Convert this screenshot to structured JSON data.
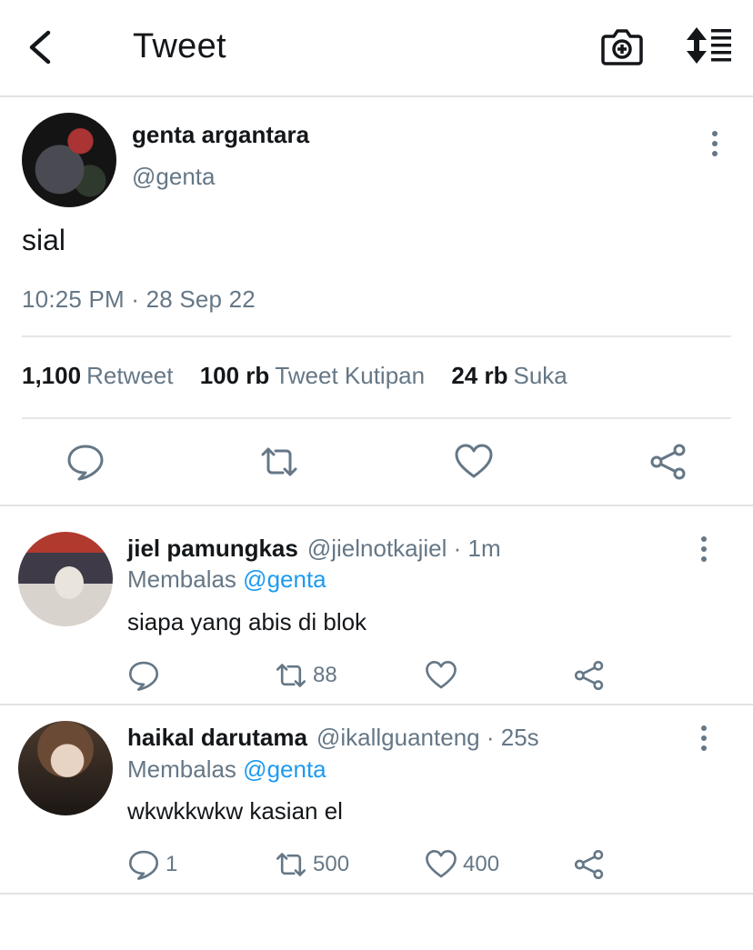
{
  "header": {
    "title": "Tweet",
    "back_icon": "chevron-left-icon",
    "camera_icon": "camera-plus-icon",
    "sort_icon": "sort-list-icon"
  },
  "main_tweet": {
    "name": "genta argantara",
    "handle": "@genta",
    "text": "sial",
    "timestamp": "10:25 PM · 28 Sep 22",
    "stats": {
      "retweets_count": "1,100",
      "retweets_label": "Retweet",
      "quotes_count": "100 rb",
      "quotes_label": "Tweet Kutipan",
      "likes_count": "24 rb",
      "likes_label": "Suka"
    }
  },
  "replies": [
    {
      "name": "jiel pamungkas",
      "handle": "@jielnotkajiel",
      "time": "· 1m",
      "replying_prefix": "Membalas",
      "replying_to": "@genta",
      "text": "siapa yang abis di blok",
      "reply_count": "",
      "retweet_count": "88",
      "like_count": ""
    },
    {
      "name": "haikal darutama",
      "handle": "@ikallguanteng",
      "time": "· 25s",
      "replying_prefix": "Membalas",
      "replying_to": "@genta",
      "text": "wkwkkwkw kasian el",
      "reply_count": "1",
      "retweet_count": "500",
      "like_count": "400"
    }
  ],
  "colors": {
    "text_primary": "#14171a",
    "text_secondary": "#657786",
    "mention": "#1d9bf0",
    "divider": "#e6e6e6"
  }
}
